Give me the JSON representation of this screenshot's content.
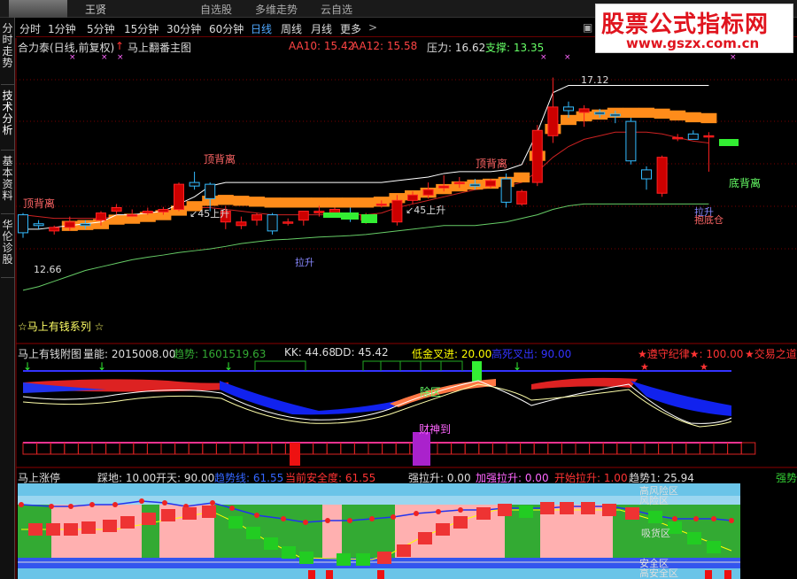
{
  "topbar": {
    "username": "王贤",
    "nav": [
      "自选股",
      "多维走势",
      "云自选"
    ]
  },
  "logo": {
    "line1": "股票公式指标网",
    "line2": "www.gszx.com.cn"
  },
  "sidebar": {
    "tabs": [
      "分时走势",
      "技术分析",
      "基本资料",
      "华伦诊股"
    ]
  },
  "periods": {
    "tabs": [
      "分时",
      "1分钟",
      "5分钟",
      "15分钟",
      "30分钟",
      "60分钟",
      "日线",
      "周线",
      "月线",
      "更多"
    ],
    "active": "日线"
  },
  "main_panel": {
    "title": "合力泰(日线,前复权)",
    "indicator": "马上翻番主图",
    "aa10": "AA10: 15.42",
    "aa12": "AA12: 15.58",
    "pressure": "压力: 16.62",
    "support": "支撑: 13.35",
    "high_label": "17.12",
    "low_label": "12.66",
    "series_label": "☆马上有钱系列 ☆",
    "annotations": [
      "顶背离",
      "顶背离",
      "顶背离",
      "底背离",
      "↙45上升",
      "↙45上升",
      "拉升",
      "拉升",
      "抱底仓"
    ]
  },
  "panel2": {
    "title": "马上有钱附图",
    "volume": "量能: 2015008.00",
    "trend": "趋势: 1601519.63",
    "kk": "KK: 44.68",
    "dd": "DD: 45.42",
    "cross_in": "低金叉进: 20.00",
    "cross_out": "高死叉出: 90.00",
    "discipline": "★遵守纪律★: 100.00",
    "trade": "★交易之道",
    "labels": [
      "除区",
      "财神到"
    ]
  },
  "panel3": {
    "title": "马上涨停",
    "ground": "踩地: 10.00",
    "sky": "开天: 90.00",
    "trend_line": "趋势线: 61.55",
    "safety": "当前安全度: 61.55",
    "strong_pull": "强拉升: 0.00",
    "add_pull": "加强拉升: 0.00",
    "start_pull": "开始拉升: 1.00",
    "trend1": "趋势1: 25.94",
    "strong_cut": "强势",
    "zones": [
      "高风险区",
      "风险区",
      "吸货区",
      "安全区",
      "高安全区"
    ]
  },
  "chart_data": {
    "type": "candlestick",
    "candles": [
      {
        "o": 13.3,
        "h": 13.35,
        "l": 12.66,
        "c": 12.8
      },
      {
        "o": 13.05,
        "h": 13.15,
        "l": 12.9,
        "c": 13.0
      },
      {
        "o": 12.85,
        "h": 13.0,
        "l": 12.75,
        "c": 12.95
      },
      {
        "o": 12.95,
        "h": 13.25,
        "l": 12.85,
        "c": 13.1
      },
      {
        "o": 13.05,
        "h": 13.15,
        "l": 12.9,
        "c": 13.0
      },
      {
        "o": 13.15,
        "h": 13.4,
        "l": 13.0,
        "c": 13.35
      },
      {
        "o": 13.4,
        "h": 13.6,
        "l": 13.3,
        "c": 13.5
      },
      {
        "o": 13.3,
        "h": 13.45,
        "l": 13.25,
        "c": 13.3
      },
      {
        "o": 13.35,
        "h": 13.5,
        "l": 13.3,
        "c": 13.4
      },
      {
        "o": 13.38,
        "h": 13.52,
        "l": 13.3,
        "c": 13.45
      },
      {
        "o": 13.45,
        "h": 14.2,
        "l": 13.4,
        "c": 14.15
      },
      {
        "o": 14.2,
        "h": 14.5,
        "l": 14.0,
        "c": 14.1
      },
      {
        "o": 14.15,
        "h": 14.2,
        "l": 13.4,
        "c": 13.75
      },
      {
        "o": 13.1,
        "h": 13.55,
        "l": 12.9,
        "c": 13.4
      },
      {
        "o": 13.0,
        "h": 13.25,
        "l": 12.9,
        "c": 13.1
      },
      {
        "o": 13.15,
        "h": 13.35,
        "l": 13.0,
        "c": 13.3
      },
      {
        "o": 13.3,
        "h": 13.35,
        "l": 12.75,
        "c": 12.85
      },
      {
        "o": 13.1,
        "h": 13.2,
        "l": 13.0,
        "c": 13.1
      },
      {
        "o": 13.15,
        "h": 13.25,
        "l": 13.0,
        "c": 13.4
      },
      {
        "o": 13.35,
        "h": 13.55,
        "l": 13.25,
        "c": 13.4
      },
      {
        "o": 13.35,
        "h": 13.5,
        "l": 13.3,
        "c": 13.45
      },
      {
        "o": 13.35,
        "h": 13.5,
        "l": 13.1,
        "c": 13.2
      },
      {
        "o": 13.15,
        "h": 13.35,
        "l": 13.05,
        "c": 13.3
      },
      {
        "o": 13.6,
        "h": 13.7,
        "l": 13.5,
        "c": 13.6
      },
      {
        "o": 13.1,
        "h": 13.85,
        "l": 13.0,
        "c": 13.7
      },
      {
        "o": 13.7,
        "h": 13.95,
        "l": 13.6,
        "c": 13.85
      },
      {
        "o": 13.85,
        "h": 14.2,
        "l": 13.75,
        "c": 14.0
      },
      {
        "o": 14.05,
        "h": 14.4,
        "l": 13.95,
        "c": 14.1
      },
      {
        "o": 14.2,
        "h": 14.35,
        "l": 14.05,
        "c": 14.2
      },
      {
        "o": 14.15,
        "h": 14.3,
        "l": 14.0,
        "c": 14.1
      },
      {
        "o": 14.1,
        "h": 14.3,
        "l": 14.05,
        "c": 14.25
      },
      {
        "o": 14.3,
        "h": 14.45,
        "l": 13.5,
        "c": 13.65
      },
      {
        "o": 13.6,
        "h": 14.0,
        "l": 13.55,
        "c": 13.95
      },
      {
        "o": 14.2,
        "h": 15.8,
        "l": 14.1,
        "c": 15.65
      },
      {
        "o": 15.5,
        "h": 17.12,
        "l": 15.3,
        "c": 16.3
      },
      {
        "o": 16.3,
        "h": 16.45,
        "l": 16.0,
        "c": 16.2
      },
      {
        "o": 16.15,
        "h": 16.35,
        "l": 15.75,
        "c": 16.25
      },
      {
        "o": 16.15,
        "h": 16.25,
        "l": 16.0,
        "c": 16.1
      },
      {
        "o": 16.1,
        "h": 16.2,
        "l": 15.85,
        "c": 16.05
      },
      {
        "o": 15.9,
        "h": 16.0,
        "l": 14.7,
        "c": 14.8
      },
      {
        "o": 14.55,
        "h": 14.65,
        "l": 14.0,
        "c": 14.3
      },
      {
        "o": 13.9,
        "h": 14.95,
        "l": 13.8,
        "c": 14.9
      },
      {
        "o": 15.45,
        "h": 15.55,
        "l": 15.35,
        "c": 15.45
      },
      {
        "o": 15.55,
        "h": 15.65,
        "l": 15.4,
        "c": 15.4
      },
      {
        "o": 15.5,
        "h": 15.6,
        "l": 14.5,
        "c": 15.5
      }
    ],
    "ma_white": [
      12.9,
      12.9,
      12.95,
      13.0,
      13.05,
      13.1,
      13.3,
      13.3,
      13.35,
      13.4,
      13.6,
      13.8,
      14.1,
      14.2,
      14.2,
      14.2,
      14.2,
      14.2,
      14.2,
      14.2,
      14.2,
      14.2,
      14.2,
      14.2,
      14.25,
      14.3,
      14.35,
      14.45,
      14.5,
      14.5,
      14.5,
      14.55,
      14.7,
      15.6,
      16.7,
      16.9,
      16.9,
      16.9,
      16.9,
      16.9,
      16.9,
      16.9,
      16.9,
      16.9,
      16.9
    ],
    "ma_red": [
      13.3,
      13.25,
      13.2,
      13.2,
      13.2,
      13.2,
      13.25,
      13.3,
      13.35,
      13.4,
      13.45,
      13.5,
      13.5,
      13.45,
      13.4,
      13.35,
      13.3,
      13.3,
      13.3,
      13.3,
      13.3,
      13.3,
      13.3,
      13.35,
      13.5,
      13.6,
      13.7,
      13.8,
      13.9,
      14.0,
      14.05,
      14.1,
      14.2,
      14.5,
      14.9,
      15.2,
      15.4,
      15.5,
      15.6,
      15.6,
      15.6,
      15.55,
      15.45,
      15.35,
      15.3
    ],
    "ma_green": [
      11.2,
      11.3,
      11.45,
      11.6,
      11.75,
      11.85,
      11.95,
      12.05,
      12.12,
      12.18,
      12.25,
      12.3,
      12.35,
      12.42,
      12.5,
      12.55,
      12.6,
      12.62,
      12.65,
      12.68,
      12.7,
      12.72,
      12.75,
      12.8,
      12.85,
      12.9,
      12.95,
      13.0,
      13.0,
      13.0,
      13.05,
      13.1,
      13.2,
      13.3,
      13.45,
      13.55,
      13.6,
      13.6,
      13.6,
      13.6,
      13.6,
      13.6,
      13.6,
      13.6,
      13.6
    ],
    "ylim": [
      10.9,
      17.8
    ]
  }
}
